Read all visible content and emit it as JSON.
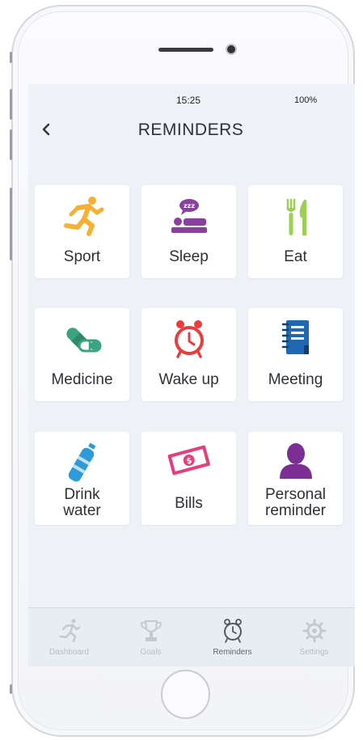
{
  "status_bar": {
    "time": "15:25",
    "battery": "100%"
  },
  "header": {
    "back_icon": "chevron-left-icon",
    "title": "REMINDERS"
  },
  "reminders": [
    {
      "label": "Sport",
      "icon": "running-person-icon",
      "color": "#f5b133"
    },
    {
      "label": "Sleep",
      "icon": "bed-sleep-icon",
      "color": "#8b3fa0"
    },
    {
      "label": "Eat",
      "icon": "fork-knife-icon",
      "color": "#9ccf52"
    },
    {
      "label": "Medicine",
      "icon": "pill-capsule-icon",
      "color": "#3aa37f"
    },
    {
      "label": "Wake up",
      "icon": "alarm-clock-icon",
      "color": "#ea3c3c"
    },
    {
      "label": "Meeting",
      "icon": "notebook-icon",
      "color": "#1f68b4"
    },
    {
      "label": "Drink water",
      "line1": "Drink",
      "line2": "water",
      "icon": "water-bottle-icon",
      "color": "#2e9ad8"
    },
    {
      "label": "Bills",
      "icon": "banknote-icon",
      "color": "#e83d7a"
    },
    {
      "label": "Personal reminder",
      "line1": "Personal",
      "line2": "reminder",
      "icon": "person-icon",
      "color": "#7b2f93"
    }
  ],
  "tabbar": {
    "tabs": [
      {
        "label": "Dashboard",
        "icon": "running-person-icon"
      },
      {
        "label": "Goals",
        "icon": "trophy-icon"
      },
      {
        "label": "Reminders",
        "icon": "alarm-clock-icon",
        "active": true
      },
      {
        "label": "Settings",
        "icon": "gear-icon"
      }
    ]
  }
}
